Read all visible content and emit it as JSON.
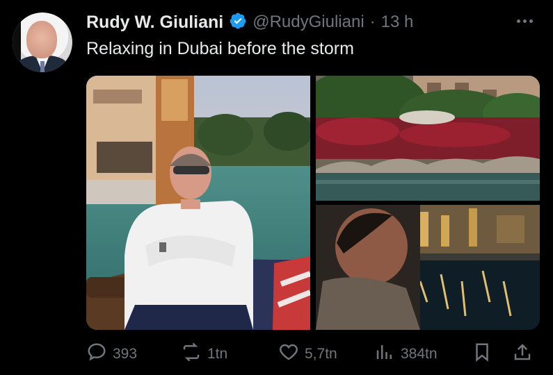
{
  "post": {
    "author_name": "Rudy W. Giuliani",
    "handle": "@RudyGiuliani",
    "separator": "·",
    "time": "13 h",
    "text": "Relaxing in Dubai before the storm"
  },
  "actions": {
    "replies": "393",
    "reposts": "1tn",
    "likes": "5,7tn",
    "views": "384tn"
  },
  "colors": {
    "background": "#000000",
    "text": "#e7e9ea",
    "muted": "#71767b",
    "verified": "#1d9bf0"
  },
  "icons": [
    "verified-badge-icon",
    "more-icon",
    "reply-icon",
    "repost-icon",
    "like-icon",
    "views-icon",
    "bookmark-icon",
    "share-icon"
  ]
}
